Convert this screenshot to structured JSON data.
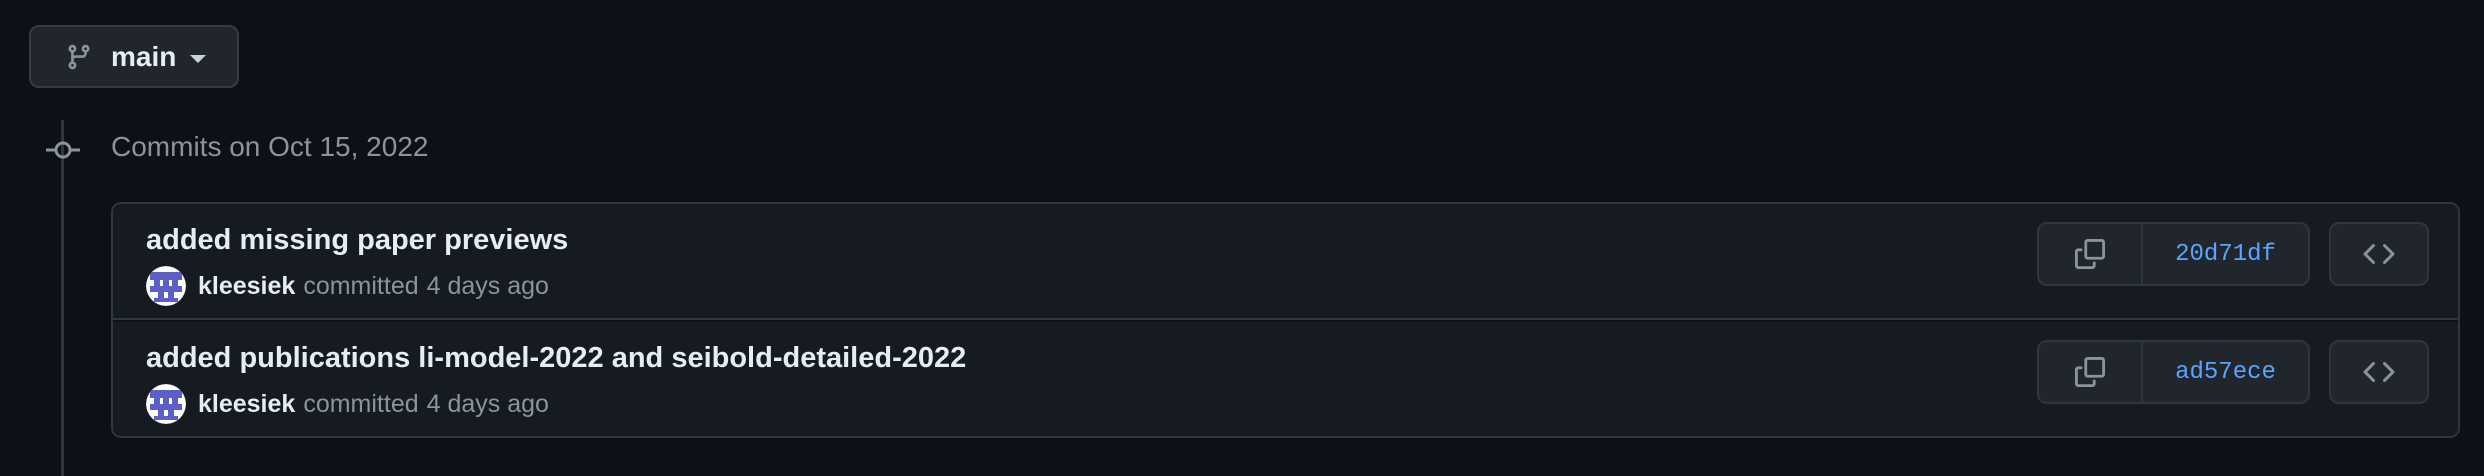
{
  "branch": {
    "name": "main",
    "icon": "git-branch-icon"
  },
  "group": {
    "header": "Commits on Oct 15, 2022"
  },
  "commits": [
    {
      "title": "added missing paper previews",
      "author": "kleesiek",
      "action": "committed",
      "time": "4 days ago",
      "sha": "20d71df"
    },
    {
      "title": "added publications li-model-2022 and seibold-detailed-2022",
      "author": "kleesiek",
      "action": "committed",
      "time": "4 days ago",
      "sha": "ad57ece"
    }
  ],
  "colors": {
    "background": "#0d1117",
    "surface": "#161b22",
    "border": "#30363d",
    "link": "#58a6ff",
    "muted": "#8b949e",
    "avatar": "#5b5fc7"
  }
}
